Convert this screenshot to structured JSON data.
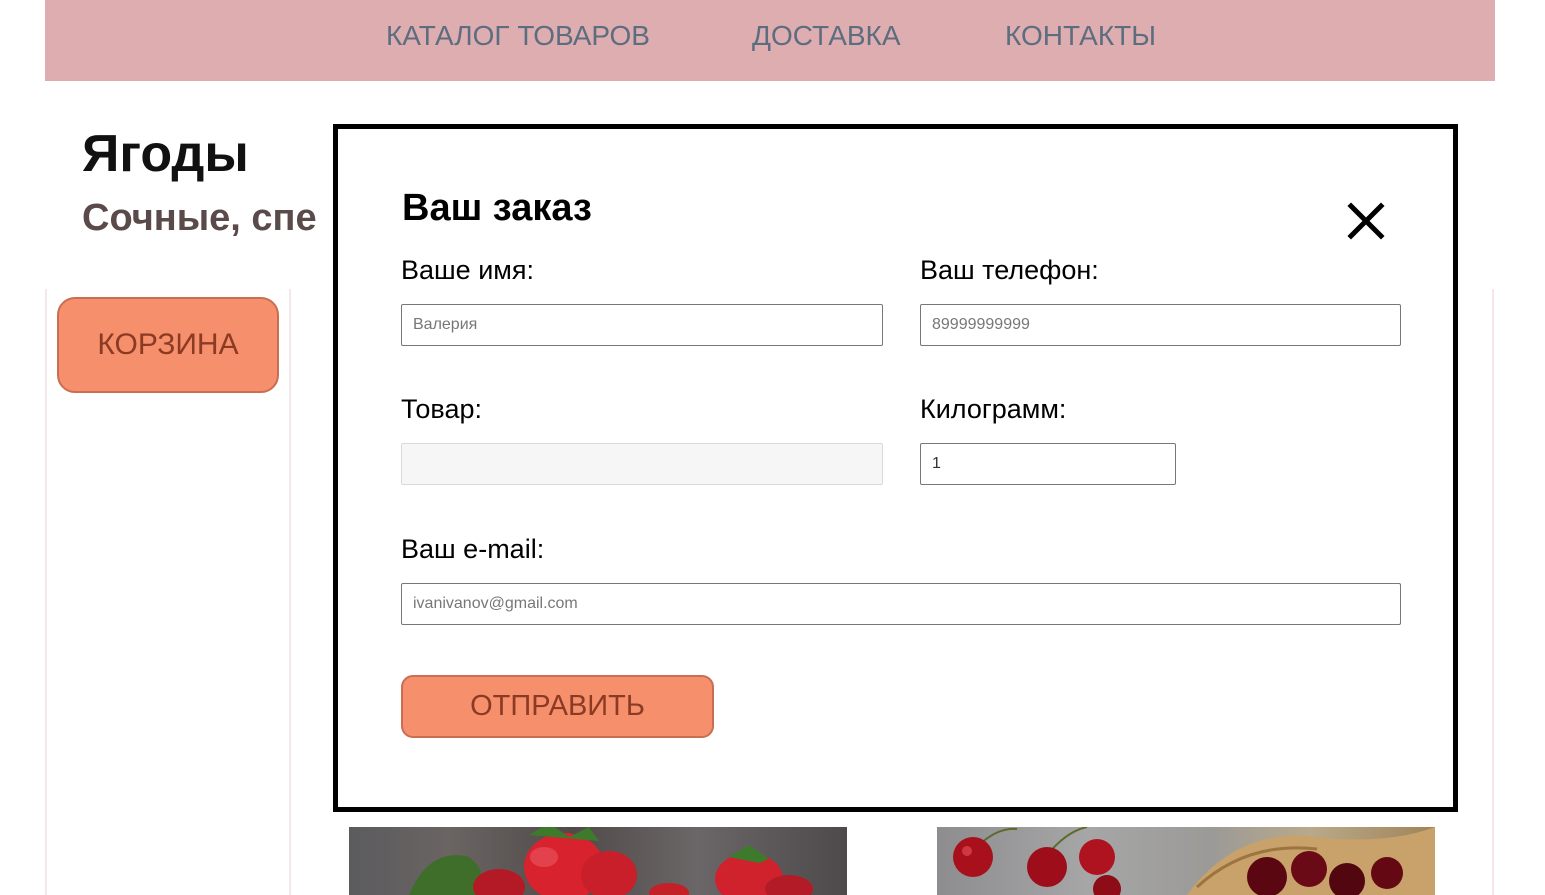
{
  "nav": {
    "items": [
      {
        "label": "КАТАЛОГ ТОВАРОВ"
      },
      {
        "label": "ДОСТАВКА"
      },
      {
        "label": "КОНТАКТЫ"
      }
    ]
  },
  "header": {
    "title": "Ягоды",
    "subtitle_visible": "Сочные, спе"
  },
  "sidebar": {
    "cart_label": "КОРЗИНА"
  },
  "order_modal": {
    "title": "Ваш заказ",
    "close_icon": "close-icon",
    "fields": {
      "name": {
        "label": "Ваше имя:",
        "placeholder": "Валерия",
        "value": ""
      },
      "phone": {
        "label": "Ваш телефон:",
        "placeholder": "89999999999",
        "value": ""
      },
      "product": {
        "label": "Товар:",
        "value": "",
        "disabled": true
      },
      "kg": {
        "label": "Килограмм:",
        "value": "1"
      },
      "email": {
        "label": "Ваш e-mail:",
        "placeholder": "ivanivanov@gmail.com",
        "value": ""
      }
    },
    "submit_label": "ОТПРАВИТЬ"
  },
  "colors": {
    "nav_bg": "#deadb0",
    "nav_text": "#5d6d80",
    "accent_button": "#f58f6c",
    "accent_button_border": "#c96e55",
    "accent_button_text": "#8b3b23",
    "modal_border": "#000000"
  },
  "products": [
    {
      "image": "strawberry-image"
    },
    {
      "image": "cherry-image"
    }
  ]
}
